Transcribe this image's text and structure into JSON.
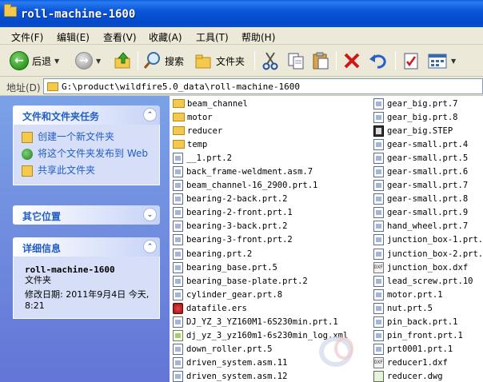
{
  "window": {
    "title": "roll-machine-1600"
  },
  "menu": [
    "文件(F)",
    "编辑(E)",
    "查看(V)",
    "收藏(A)",
    "工具(T)",
    "帮助(H)"
  ],
  "toolbar": {
    "back_label": "后退",
    "search_label": "搜索",
    "folders_label": "文件夹"
  },
  "address": {
    "label": "地址(D)",
    "path": "G:\\product\\wildfire5.0_data\\roll-machine-1600"
  },
  "tasks_panel": {
    "title": "文件和文件夹任务",
    "items": [
      "创建一个新文件夹",
      "将这个文件夹发布到 Web",
      "共享此文件夹"
    ]
  },
  "other_panel": {
    "title": "其它位置"
  },
  "details_panel": {
    "title": "详细信息",
    "name": "roll-machine-1600",
    "type": "文件夹",
    "modified": "修改日期: 2011年9月4日 今天, 8:21"
  },
  "files_col1": [
    {
      "name": "beam_channel",
      "icon": "folder"
    },
    {
      "name": "motor",
      "icon": "folder"
    },
    {
      "name": "reducer",
      "icon": "folder"
    },
    {
      "name": "temp",
      "icon": "folder"
    },
    {
      "name": "__1.prt.2",
      "icon": "doc"
    },
    {
      "name": "back_frame-weldment.asm.7",
      "icon": "doc"
    },
    {
      "name": "beam_channel-16_2900.prt.1",
      "icon": "doc"
    },
    {
      "name": "bearing-2-back.prt.2",
      "icon": "doc"
    },
    {
      "name": "bearing-2-front.prt.1",
      "icon": "doc"
    },
    {
      "name": "bearing-3-back.prt.2",
      "icon": "doc"
    },
    {
      "name": "bearing-3-front.prt.2",
      "icon": "doc"
    },
    {
      "name": "bearing.prt.2",
      "icon": "doc"
    },
    {
      "name": "bearing_base.prt.5",
      "icon": "doc"
    },
    {
      "name": "bearing_base-plate.prt.2",
      "icon": "doc"
    },
    {
      "name": "cylinder_gear.prt.8",
      "icon": "doc"
    },
    {
      "name": "datafile.ers",
      "icon": "ers"
    },
    {
      "name": "DJ_YZ_3_YZ160M1-6S230min.prt.1",
      "icon": "doc"
    },
    {
      "name": "dj_yz_3_yz160m1-6s230min_log.xml",
      "icon": "xml"
    },
    {
      "name": "down_roller.prt.5",
      "icon": "doc"
    },
    {
      "name": "driven_system.asm.11",
      "icon": "doc"
    },
    {
      "name": "driven_system.asm.12",
      "icon": "doc"
    }
  ],
  "files_col2": [
    {
      "name": "gear_big.prt.7",
      "icon": "doc"
    },
    {
      "name": "gear_big.prt.8",
      "icon": "doc"
    },
    {
      "name": "gear_big.STEP",
      "icon": "step"
    },
    {
      "name": "gear-small.prt.4",
      "icon": "doc"
    },
    {
      "name": "gear-small.prt.5",
      "icon": "doc"
    },
    {
      "name": "gear-small.prt.6",
      "icon": "doc"
    },
    {
      "name": "gear-small.prt.7",
      "icon": "doc"
    },
    {
      "name": "gear-small.prt.8",
      "icon": "doc"
    },
    {
      "name": "gear-small.prt.9",
      "icon": "doc"
    },
    {
      "name": "hand_wheel.prt.7",
      "icon": "doc"
    },
    {
      "name": "junction_box-1.prt.2",
      "icon": "doc"
    },
    {
      "name": "junction_box-2.prt.1",
      "icon": "doc"
    },
    {
      "name": "junction_box.dxf",
      "icon": "dxf"
    },
    {
      "name": "lead_screw.prt.10",
      "icon": "doc"
    },
    {
      "name": "motor.prt.1",
      "icon": "doc"
    },
    {
      "name": "nut.prt.5",
      "icon": "doc"
    },
    {
      "name": "pin_back.prt.1",
      "icon": "doc"
    },
    {
      "name": "pin_front.prt.1",
      "icon": "doc"
    },
    {
      "name": "prt0001.prt.1",
      "icon": "doc"
    },
    {
      "name": "reducer1.dxf",
      "icon": "dxf"
    },
    {
      "name": "reducer.dwg",
      "icon": "dwg"
    }
  ]
}
